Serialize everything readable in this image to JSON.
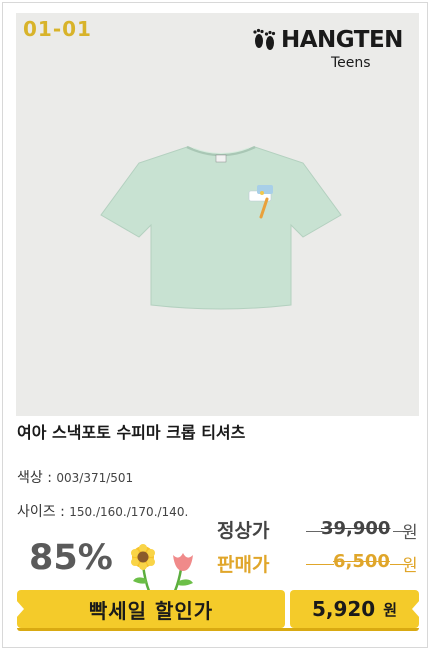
{
  "product": {
    "item_code": "01-01",
    "brand": {
      "name": "HANGTEN",
      "sub": "Teens"
    },
    "title": "여아 스낵포토 수피마 크롭 티셔츠",
    "color_label": "색상 :",
    "color_value": "003/371/501",
    "size_label": "사이즈 :",
    "size_value": "150./160./170./140."
  },
  "pricing": {
    "discount": "85%",
    "normal_label": "정상가",
    "normal_price": "39,900",
    "sale_label": "판매가",
    "sale_price": "6,500",
    "unit": "원",
    "flash_label": "빡세일 할인가",
    "final_price": "5,920",
    "final_unit": "원"
  },
  "colors": {
    "accent_yellow": "#f4cb2a",
    "code_gold": "#d8b32a",
    "sale_orange": "#e0a62a",
    "shirt_mint": "#c8e2d2",
    "photo_bg": "#ebebe9"
  },
  "icons": [
    "hangten-feet-logo-icon",
    "sunflower-tulip-icon"
  ]
}
